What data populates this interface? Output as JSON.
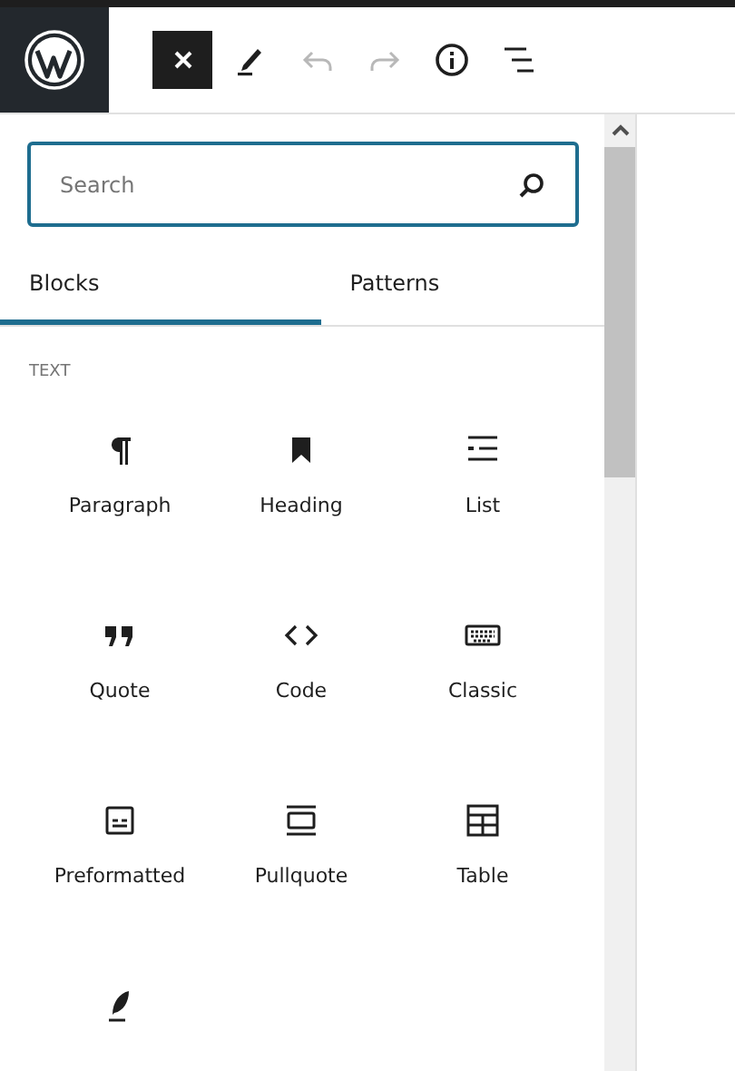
{
  "toolbar": [
    {
      "kind": "close",
      "pressed": true,
      "disabled": false
    },
    {
      "kind": "pencil",
      "pressed": false,
      "disabled": false
    },
    {
      "kind": "undo",
      "pressed": false,
      "disabled": true
    },
    {
      "kind": "redo",
      "pressed": false,
      "disabled": true
    },
    {
      "kind": "info",
      "pressed": false,
      "disabled": false
    },
    {
      "kind": "outline",
      "pressed": false,
      "disabled": false
    }
  ],
  "search": {
    "placeholder": "Search"
  },
  "tabs": [
    {
      "label": "Blocks",
      "selected": true
    },
    {
      "label": "Patterns",
      "selected": false
    }
  ],
  "category": "TEXT",
  "blocks": [
    {
      "kind": "paragraph",
      "label": "Paragraph"
    },
    {
      "kind": "heading",
      "label": "Heading"
    },
    {
      "kind": "list",
      "label": "List"
    },
    {
      "kind": "quote",
      "label": "Quote"
    },
    {
      "kind": "code",
      "label": "Code"
    },
    {
      "kind": "classic",
      "label": "Classic"
    },
    {
      "kind": "preformatted",
      "label": "Preformatted"
    },
    {
      "kind": "pullquote",
      "label": "Pullquote"
    },
    {
      "kind": "table",
      "label": "Table"
    },
    {
      "kind": "verse"
    }
  ]
}
